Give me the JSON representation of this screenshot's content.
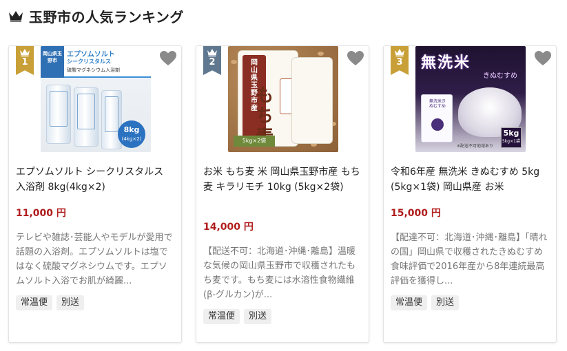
{
  "header": {
    "title": "玉野市の人気ランキング",
    "icon": "crown-icon"
  },
  "colors": {
    "price": "#b01c1c",
    "rank_gold": "#c8a037",
    "rank_slate": "#5f7890",
    "tag_bg": "#efefef"
  },
  "items": [
    {
      "rank": "1",
      "title": "エプソムソルト シークリスタルス 入浴剤 8kg(4kg×2)",
      "price": "11,000 円",
      "description": "テレビや雑誌･芸能人やモデルが愛用で話題の入浴剤。エプソムソルトは塩ではなく硫酸マグネシウムです。エプソムソルト入浴でお肌が綺麗...",
      "tags": [
        "常温便",
        "別送"
      ],
      "image": {
        "city": "岡山県玉野市",
        "line1": "エプソムソルト",
        "line2": "シークリスタルス",
        "line3": "硫酸マグネシウム入浴剤",
        "weight": "8kg",
        "weight_sub": "(4kg×2)"
      }
    },
    {
      "rank": "2",
      "title": "お米 もち麦 米 岡山県玉野市産 もち麦 キラリモチ 10kg (5kg×2袋)",
      "price": "14,000 円",
      "description": "【配送不可：北海道･沖縄･離島】温暖な気候の岡山県玉野市で収穫されたもち麦です。もち麦には水溶性食物繊維(β-グルカン)が...",
      "tags": [
        "常温便",
        "別送"
      ],
      "image": {
        "side": "岡山県玉野市産",
        "big": "もち麦",
        "foot": "5kg×2袋"
      }
    },
    {
      "rank": "3",
      "title": "令和6年産 無洗米 きぬむすめ 5kg (5kg×1袋) 岡山県産 お米",
      "price": "15,000 円",
      "description": "【配達不可：北海道･沖縄･離島】「晴れの国」岡山県で収穫されたきぬむすめ 食味評価で2016年産から8年連続最高評価を獲得し...",
      "tags": [
        "常温便",
        "別送"
      ],
      "image": {
        "headline": "無洗米",
        "sub": "きぬむすめ",
        "bag": "無洗米きぬむすめ",
        "weight": "5kg",
        "weight_sub": "5kg×1袋",
        "note": "※配送不可地域あり"
      }
    }
  ]
}
